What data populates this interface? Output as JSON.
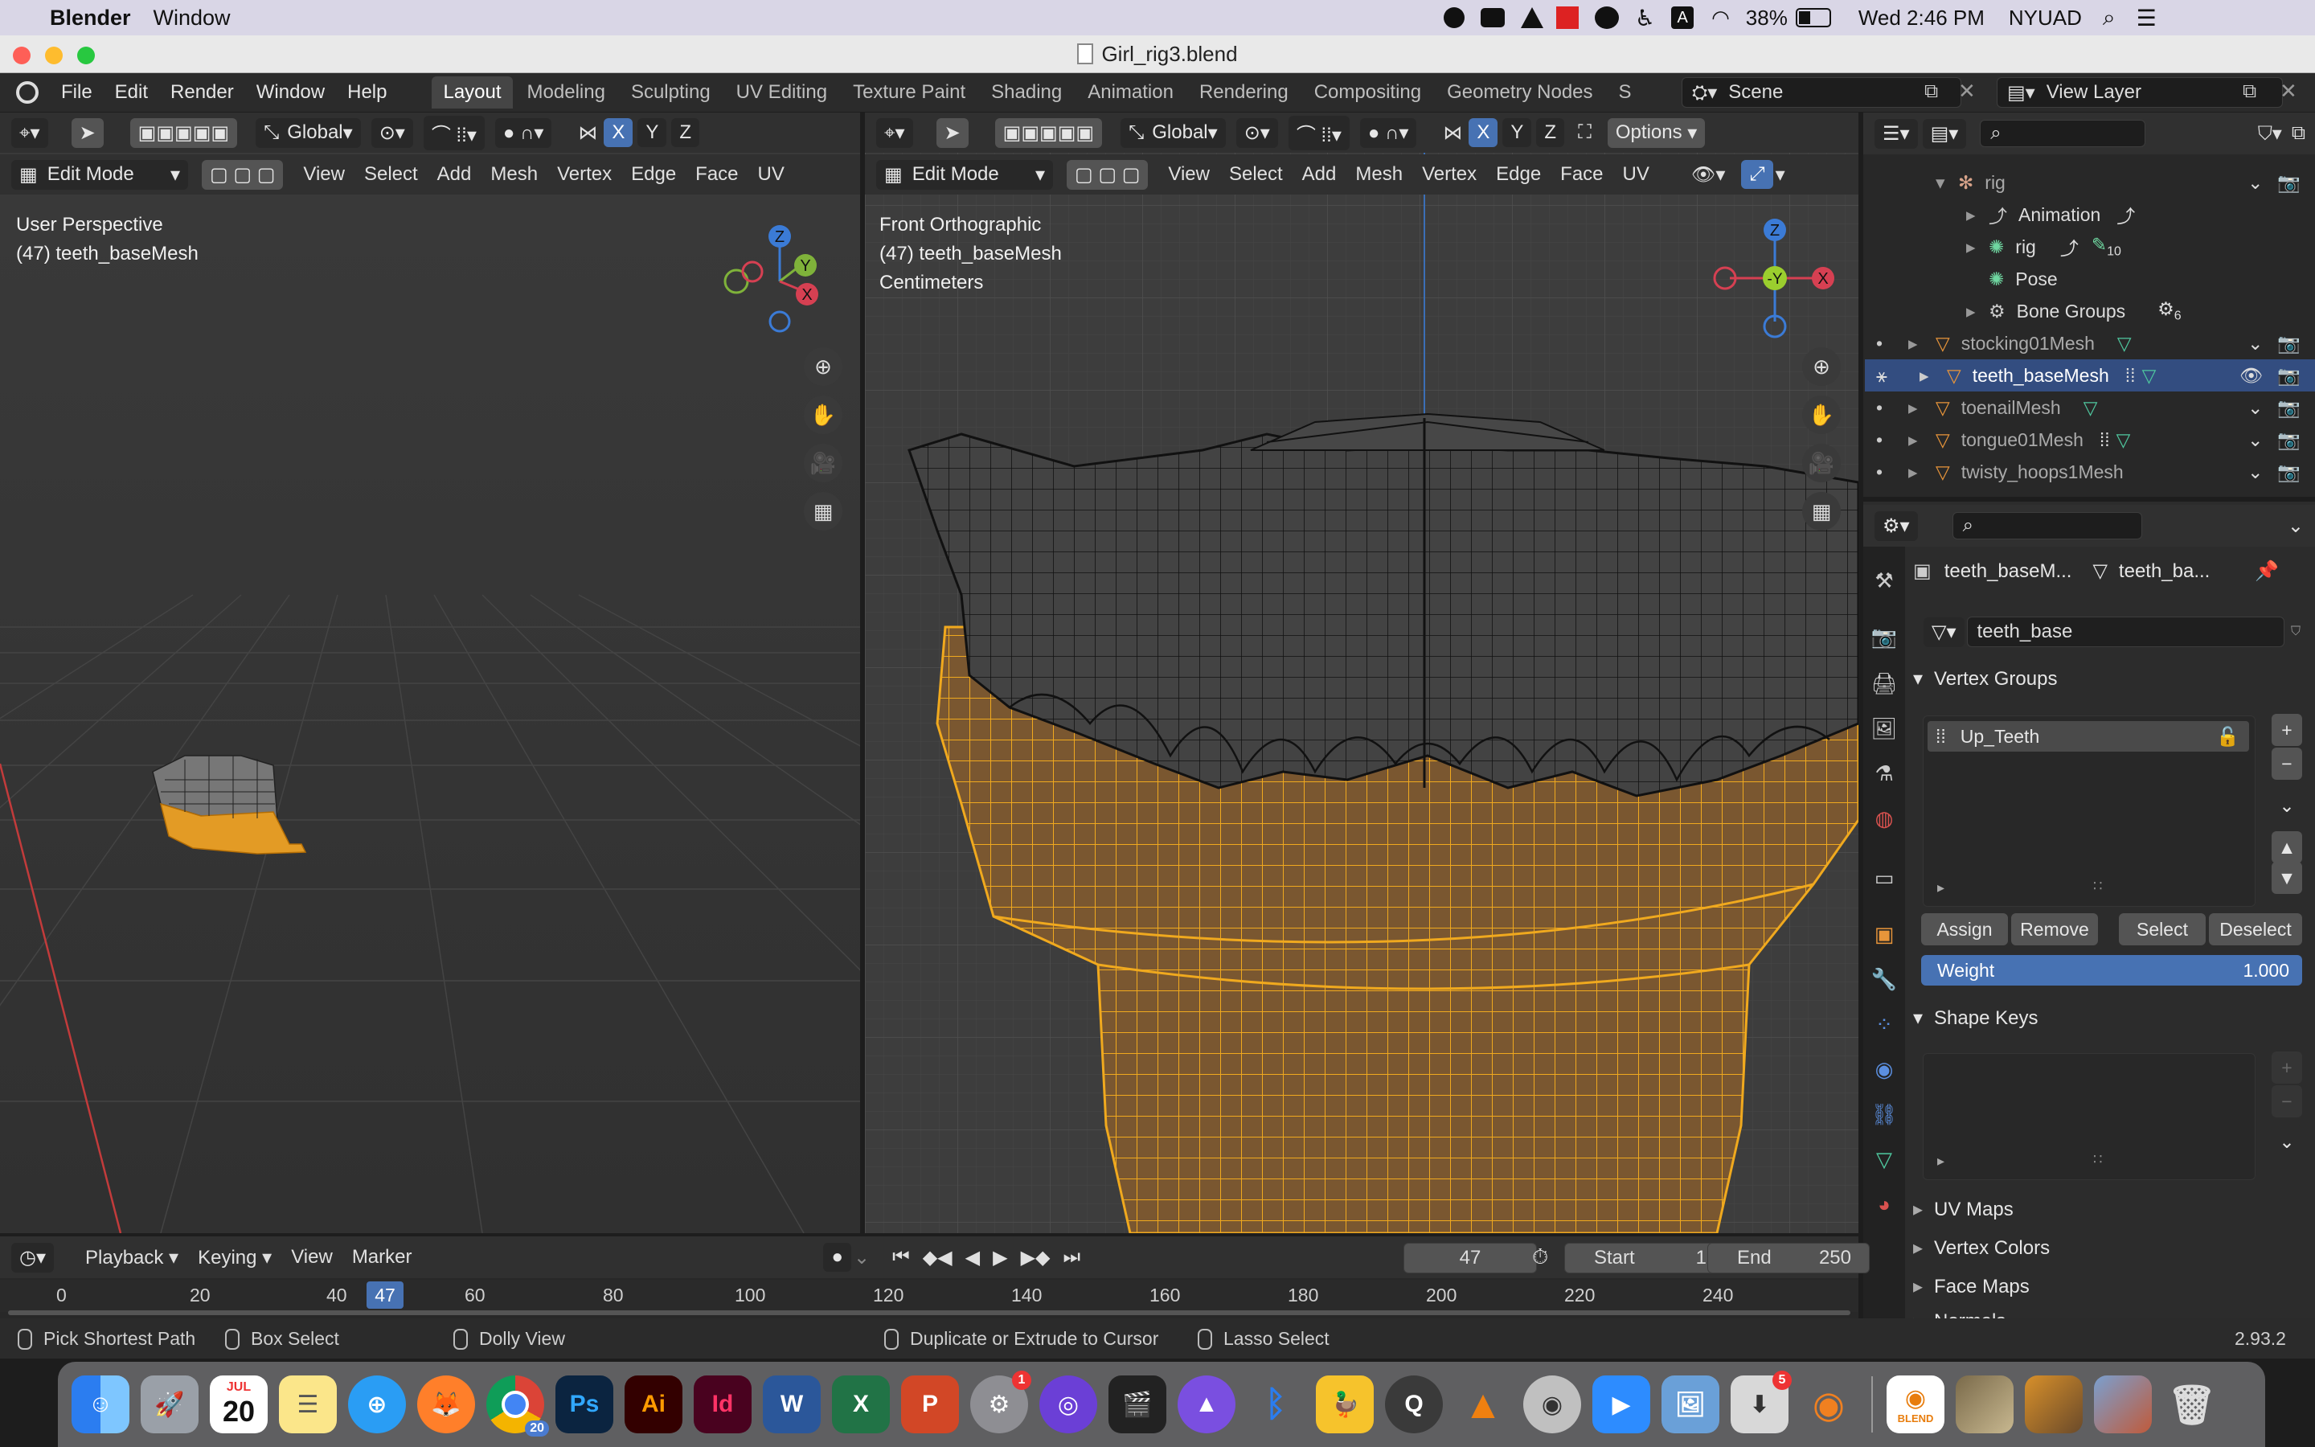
{
  "mac": {
    "apple": "",
    "app_name": "Blender",
    "menu": [
      "Window"
    ],
    "battery": "38%",
    "datetime": "Wed 2:46 PM",
    "network": "NYUAD"
  },
  "window": {
    "title": "Girl_rig3.blend"
  },
  "topbar": {
    "menus": [
      "File",
      "Edit",
      "Render",
      "Window",
      "Help"
    ],
    "workspaces": [
      "Layout",
      "Modeling",
      "Sculpting",
      "UV Editing",
      "Texture Paint",
      "Shading",
      "Animation",
      "Rendering",
      "Compositing",
      "Geometry Nodes",
      "S"
    ],
    "active_workspace": "Layout",
    "scene": "Scene",
    "view_layer": "View Layer"
  },
  "left_view": {
    "transform": "Global",
    "mode": "Edit Mode",
    "menus": [
      "View",
      "Select",
      "Add",
      "Mesh",
      "Vertex",
      "Edge",
      "Face",
      "UV"
    ],
    "axes": [
      "X",
      "Y",
      "Z"
    ],
    "overlay_line1": "User Perspective",
    "overlay_line2": "(47) teeth_baseMesh",
    "gizmo": {
      "z": "Z",
      "y": "Y",
      "x": "X"
    }
  },
  "right_view": {
    "transform": "Global",
    "mode": "Edit Mode",
    "menus": [
      "View",
      "Select",
      "Add",
      "Mesh",
      "Vertex",
      "Edge",
      "Face",
      "UV"
    ],
    "axes": [
      "X",
      "Y",
      "Z"
    ],
    "options": "Options",
    "overlay_line1": "Front Orthographic",
    "overlay_line2": "(47) teeth_baseMesh",
    "overlay_line3": "Centimeters",
    "gizmo": {
      "z": "Z",
      "y": "-Y",
      "x": "X"
    }
  },
  "outliner": {
    "items": [
      {
        "label": "rig",
        "indent": 1,
        "selected": false,
        "muted": true
      },
      {
        "label": "Animation",
        "indent": 2,
        "selected": false,
        "muted": false
      },
      {
        "label": "rig",
        "indent": 2,
        "selected": false,
        "muted": false,
        "badge": "10"
      },
      {
        "label": "Pose",
        "indent": 2,
        "selected": false,
        "muted": false
      },
      {
        "label": "Bone Groups",
        "indent": 2,
        "selected": false,
        "muted": false,
        "badge": "6"
      },
      {
        "label": "stocking01Mesh",
        "indent": 1,
        "selected": false,
        "muted": true
      },
      {
        "label": "teeth_baseMesh",
        "indent": 1,
        "selected": true,
        "muted": false
      },
      {
        "label": "toenailMesh",
        "indent": 1,
        "selected": false,
        "muted": true
      },
      {
        "label": "tongue01Mesh",
        "indent": 1,
        "selected": false,
        "muted": true
      },
      {
        "label": "twisty_hoops1Mesh",
        "indent": 1,
        "selected": false,
        "muted": true
      }
    ]
  },
  "properties": {
    "object_name": "teeth_baseM...",
    "data_name": "teeth_ba...",
    "mesh_name": "teeth_base",
    "vertex_groups_title": "Vertex Groups",
    "vertex_group_item": "Up_Teeth",
    "assign": "Assign",
    "remove": "Remove",
    "select": "Select",
    "deselect": "Deselect",
    "weight_label": "Weight",
    "weight_value": "1.000",
    "shape_keys_title": "Shape Keys",
    "uv_maps": "UV Maps",
    "vertex_colors": "Vertex Colors",
    "face_maps": "Face Maps",
    "normals": "Normals"
  },
  "timeline": {
    "menus": [
      "Playback",
      "Keying",
      "View",
      "Marker"
    ],
    "current_frame": "47",
    "start_label": "Start",
    "start_value": "1",
    "end_label": "End",
    "end_value": "250",
    "ticks": [
      "0",
      "20",
      "40",
      "60",
      "80",
      "100",
      "120",
      "140",
      "160",
      "180",
      "200",
      "220",
      "240"
    ],
    "playhead": "47"
  },
  "status": {
    "items": [
      "Pick Shortest Path",
      "Box Select",
      "Dolly View",
      "Duplicate or Extrude to Cursor",
      "Lasso Select"
    ],
    "version": "2.93.2"
  },
  "dock": {
    "calendar_month": "JUL",
    "calendar_day": "20",
    "chrome_badge": "20",
    "settings_badge": "1",
    "app_badge": "5",
    "ps": "Ps",
    "ai": "Ai",
    "id": "Id",
    "word": "W",
    "excel": "X",
    "ppt": "P",
    "blend_file": "BLEND"
  }
}
